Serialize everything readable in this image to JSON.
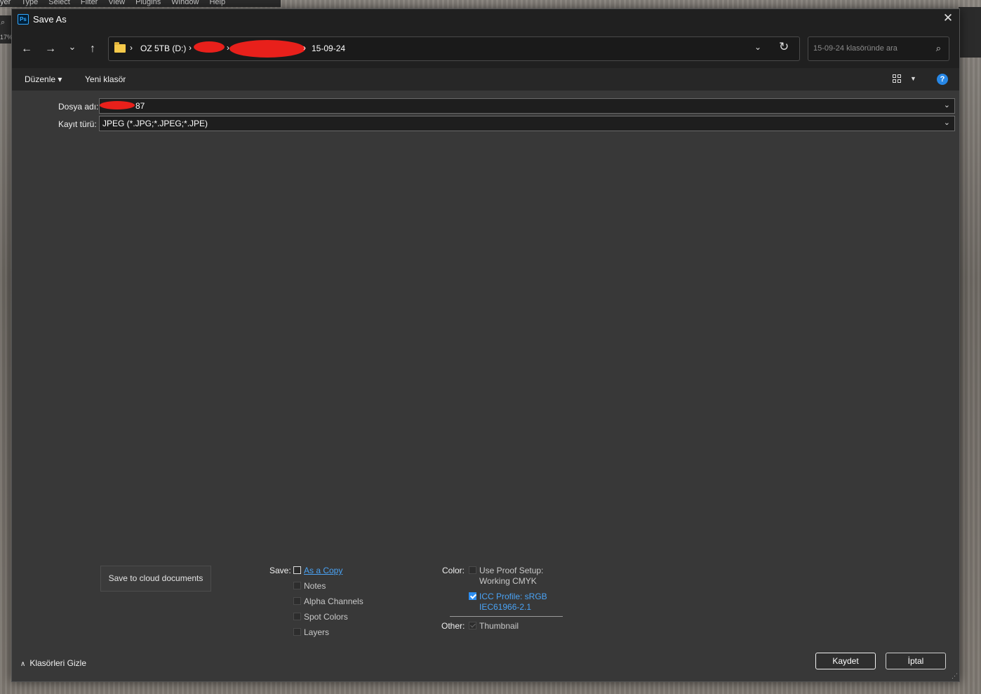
{
  "background": {
    "menu_items": [
      "yer",
      "Type",
      "Select",
      "Filter",
      "View",
      "Plugins",
      "Window",
      "Help"
    ],
    "zoom_text": "17%"
  },
  "dialog": {
    "title": "Save As",
    "app_icon_text": "Ps",
    "close_glyph": "✕"
  },
  "nav": {
    "back_glyph": "←",
    "forward_glyph": "→",
    "recent_glyph": "⌄",
    "up_glyph": "↑",
    "breadcrumb": {
      "arrow1": "›",
      "drive": "OZ 5TB (D:)",
      "arrow2": "›",
      "arrow3": "›",
      "arrow4": "›",
      "current_folder": "15-09-24"
    },
    "refresh_glyph": "↻",
    "dropdown_glyph": "⌄",
    "search_placeholder": "15-09-24 klasöründe ara",
    "search_glyph": "⌕"
  },
  "commandbar": {
    "organize_label": "Düzenle ▾",
    "new_folder_label": "Yeni klasör",
    "help_label": "?"
  },
  "fields": {
    "filename_label": "Dosya adı:",
    "filename_value": "87",
    "filetype_label": "Kayıt türü:",
    "filetype_value": "JPEG (*.JPG;*.JPEG;*.JPE)",
    "caret_glyph": "⌄"
  },
  "options": {
    "cloud_button": "Save to cloud documents",
    "save_label": "Save:",
    "save_items": [
      {
        "label": "As a Copy",
        "checked": false
      },
      {
        "label": "Notes",
        "checked": false
      },
      {
        "label": "Alpha Channels",
        "checked": false
      },
      {
        "label": "Spot Colors",
        "checked": false
      },
      {
        "label": "Layers",
        "checked": false
      }
    ],
    "color_label": "Color:",
    "proof_setup_line1": "Use Proof Setup:",
    "proof_setup_line2": "Working CMYK",
    "icc_line1": "ICC Profile:  sRGB",
    "icc_line2": "IEC61966-2.1",
    "other_label": "Other:",
    "thumbnail_label": "Thumbnail"
  },
  "footer": {
    "hide_folders_label": "Klasörleri Gizle",
    "hide_folders_glyph": "∧",
    "save_button": "Kaydet",
    "cancel_button": "İptal"
  },
  "colors": {
    "dialog_bg": "#383838",
    "titlebar_bg": "#202020",
    "accent_blue": "#2c8df0",
    "link_blue": "#4aa3f5",
    "redaction_red": "#e8201b"
  }
}
